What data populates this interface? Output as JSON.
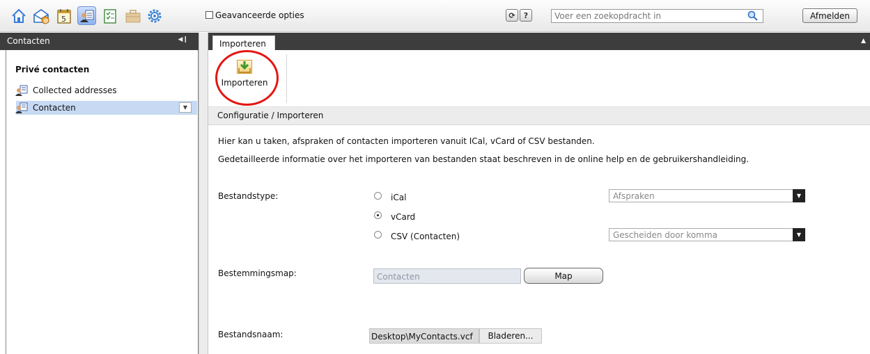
{
  "toolbar": {
    "icons": [
      "home-icon",
      "mail-icon",
      "calendar-icon",
      "contacts-icon",
      "tasks-icon",
      "briefcase-icon",
      "settings-icon"
    ],
    "calendar_day": "5",
    "advanced_options_label": "Geavanceerde opties",
    "advanced_options_checked": false,
    "refresh_glyph": "⟳",
    "help_glyph": "?",
    "search_placeholder": "Voer een zoekopdracht in",
    "logout_label": "Afmelden",
    "active_icon": "contacts-icon"
  },
  "sidebar": {
    "title": "Contacten",
    "collapse_glyph": "◀❙",
    "section_heading": "Privé contacten",
    "folders": [
      {
        "label": "Collected addresses",
        "selected": false
      },
      {
        "label": "Contacten",
        "selected": true
      }
    ],
    "dropdown_glyph": "▼"
  },
  "main": {
    "tab_label": "Importeren",
    "collapse_glyph": "▲",
    "ribbon_button_label": "Importeren",
    "breadcrumb": "Configuratie / Importeren",
    "intro_line1": "Hier kan u taken, afspraken of contacten importeren vanuit ICal, vCard of CSV bestanden.",
    "intro_line2": "Gedetailleerde informatie over het importeren van bestanden staat beschreven in de online help en de gebruikershandleiding.",
    "filetype_label": "Bestandstype:",
    "filetype_options": [
      {
        "label": "iCal",
        "checked": false
      },
      {
        "label": "vCard",
        "checked": true
      },
      {
        "label": "CSV (Contacten)",
        "checked": false
      }
    ],
    "ical_target_select": "Afspraken",
    "csv_separator_select": "Gescheiden door komma",
    "destination_label": "Bestemmingsmap:",
    "destination_value": "Contacten",
    "map_button": "Map",
    "filename_label": "Bestandsnaam:",
    "filename_value": "Desktop\\MyContacts.vcf",
    "browse_button": "Bladeren..."
  },
  "colors": {
    "dark_header": "#3d3d3d",
    "selection": "#c7d9f3",
    "highlight_ring": "#e41612",
    "active_toolbar_icon": "#8db2ef"
  }
}
